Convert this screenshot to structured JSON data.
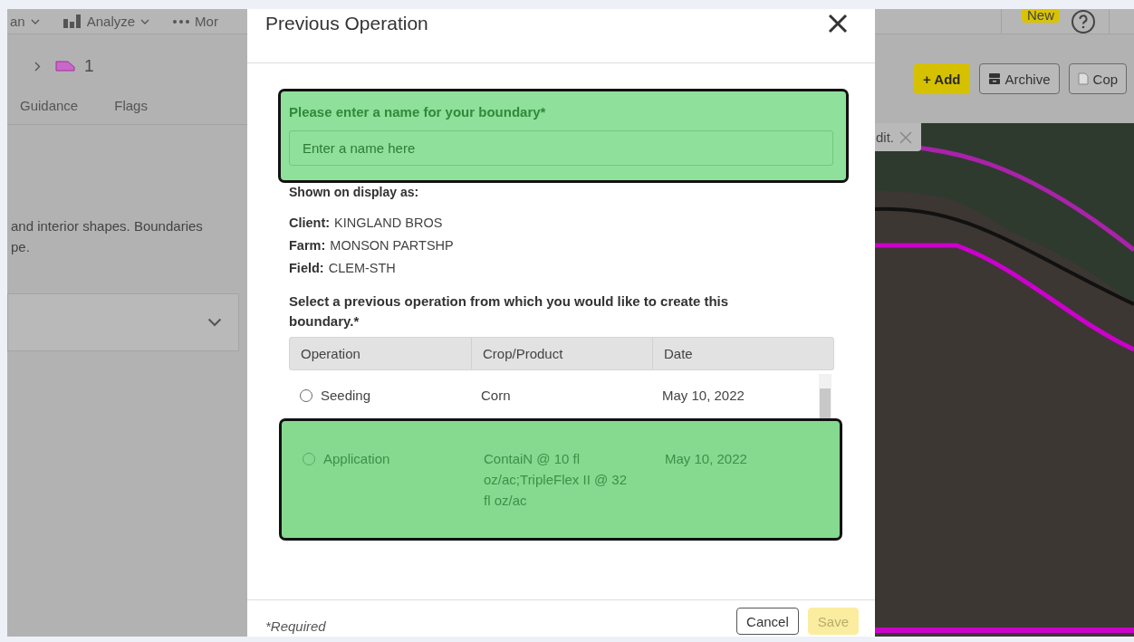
{
  "app_bar": {
    "menu": [
      {
        "label": "an",
        "kind": "dropdown"
      },
      {
        "label": "Analyze",
        "kind": "chart"
      },
      {
        "label": "Mor",
        "kind": "more"
      }
    ],
    "badge": "New"
  },
  "breadcrumb": {
    "current": "1"
  },
  "tabs": [
    {
      "label": "Guidance",
      "selected": false
    },
    {
      "label": "Flags",
      "selected": false
    }
  ],
  "description": [
    "and interior shapes. Boundaries",
    "pe."
  ],
  "toolbar": [
    {
      "label": "+ Add",
      "kind": "primary"
    },
    {
      "label": "Archive",
      "kind": "archive"
    },
    {
      "label": "Cop",
      "kind": "copy"
    }
  ],
  "map": {
    "tip": "dit."
  },
  "dialog": {
    "title": "Previous Operation",
    "name_field": {
      "label": "Please enter a name for your boundary*",
      "placeholder": "Enter a name here",
      "highlighted": true
    },
    "display_heading": "Shown on display as:",
    "details": [
      {
        "label": "Client:",
        "value": "KINGLAND BROS"
      },
      {
        "label": "Farm:",
        "value": "MONSON PARTSHP"
      },
      {
        "label": "Field:",
        "value": "CLEM-STH"
      }
    ],
    "prompt": "Select a previous operation from which you would like to create this boundary.*",
    "table": {
      "columns": [
        "Operation",
        "Crop/Product",
        "Date"
      ],
      "rows": [
        {
          "operation": "Seeding",
          "crop": "Corn",
          "date": "May 10, 2022",
          "selected": false,
          "highlighted": false
        },
        {
          "operation": "Application",
          "crop": "ContaiN @ 10 fl oz/ac;TripleFlex II @ 32 fl oz/ac",
          "date": "May 10, 2022",
          "selected": false,
          "highlighted": true
        }
      ]
    },
    "footnote": "*Required",
    "buttons": [
      {
        "label": "Cancel",
        "kind": "secondary",
        "disabled": false
      },
      {
        "label": "Save",
        "kind": "primary",
        "disabled": true
      }
    ]
  }
}
